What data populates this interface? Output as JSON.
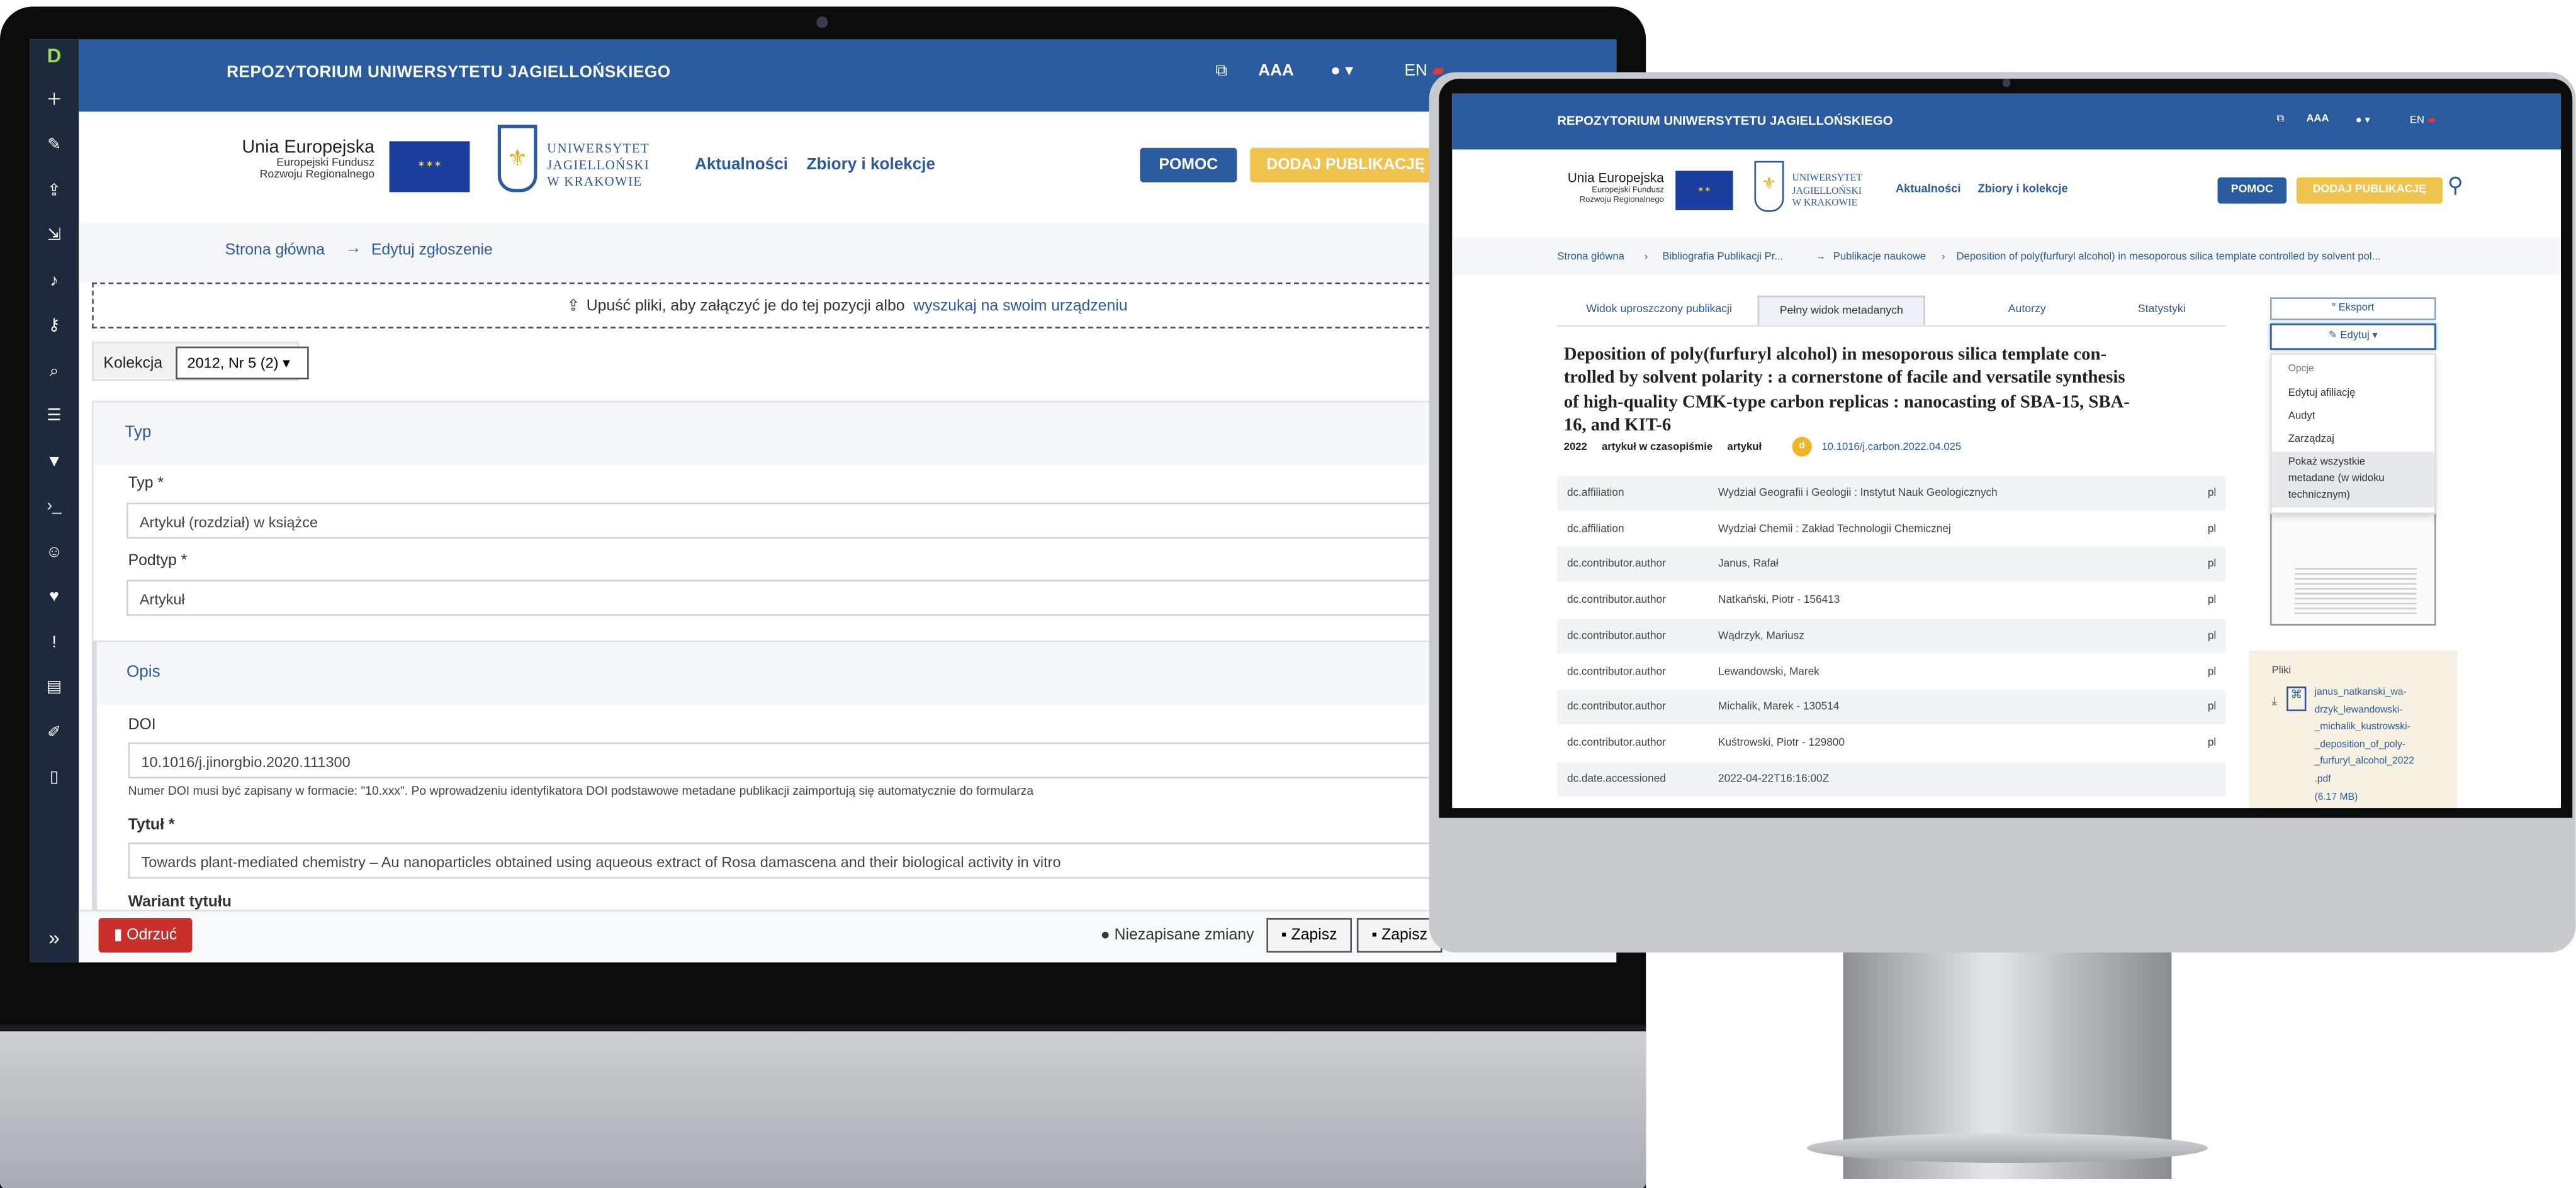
{
  "repo_title": "REPOZYTORIUM UNIWERSYTETU JAGIELLOŃSKIEGO",
  "header": {
    "font_size": "AAA",
    "lang": "EN"
  },
  "eu": {
    "name": "Unia Europejska",
    "line1": "Europejski Fundusz",
    "line2": "Rozwoju Regionalnego"
  },
  "uj": {
    "line1": "UNIWERSYTET",
    "line2": "JAGIELLOŃSKI",
    "line3": "W KRAKOWIE"
  },
  "nav": {
    "news": "Aktualności",
    "collections": "Zbiory i kolekcje"
  },
  "buttons": {
    "help": "POMOC",
    "add": "DODAJ PUBLIKACJĘ"
  },
  "laptop": {
    "breadcrumb": {
      "home": "Strona główna",
      "arrow": "→",
      "current": "Edytuj zgłoszenie"
    },
    "drop": {
      "text": "Upuść pliki, aby załączyć je do tej pozycji albo",
      "link": "wyszukaj na swoim urządzeniu"
    },
    "collection": {
      "label": "Kolekcja",
      "value": "2012, Nr 5 (2)"
    },
    "typ_panel": {
      "title": "Typ",
      "type_label": "Typ *",
      "type_value": "Artykuł (rozdział) w książce",
      "subtype_label": "Podtyp *",
      "subtype_value": "Artykuł"
    },
    "opis_panel": {
      "title": "Opis",
      "doi_label": "DOI",
      "doi_value": "10.1016/j.jinorgbio.2020.111300",
      "doi_help": "Numer DOI musi być zapisany w formacie: \"10.xxx\". Po wprowadzeniu identyfikatora DOI podstawowe metadane publikacji zaimportują się automatycznie do formularza",
      "title_label": "Tytuł *",
      "title_value": "Towards plant-mediated chemistry – Au nanoparticles obtained using aqueous extract of Rosa damascena and their biological activity in vitro",
      "variant_label": "Wariant tytułu"
    },
    "footer": {
      "discard": "Odrzuć",
      "unsaved": "Niezapisane zmiany",
      "save": "Zapisz",
      "save2": "Zapisz"
    }
  },
  "monitor": {
    "breadcrumb": {
      "home": "Strona główna",
      "b2": "Bibliografia Publikacji Pr...",
      "b3": "Publikacje naukowe",
      "b4": "Deposition of poly(furfuryl alcohol) in mesoporous silica template controlled by solvent pol..."
    },
    "tabs": [
      "Widok uproszczony publikacji",
      "Pełny widok metadanych",
      "Autorzy",
      "Statystyki"
    ],
    "title": [
      "Deposition of poly(furfuryl alcohol) in mesoporous silica template con-",
      "trolled by solvent polarity : a cornerstone of facile and versatile synthesis",
      "of high-quality CMK-type carbon replicas : nanocasting of SBA-15, SBA-",
      "16, and KIT-6"
    ],
    "meta": {
      "year": "2022",
      "kind": "artykuł w czasopiśmie",
      "sub": "artykuł",
      "doi": "10.1016/j.carbon.2022.04.025"
    },
    "rows": [
      {
        "key": "dc.affiliation",
        "value": "Wydział Geografii i Geologii : Instytut Nauk Geologicznych",
        "lang": "pl"
      },
      {
        "key": "dc.affiliation",
        "value": "Wydział Chemii : Zakład Technologii Chemicznej",
        "lang": "pl"
      },
      {
        "key": "dc.contributor.author",
        "value": "Janus, Rafał",
        "lang": "pl"
      },
      {
        "key": "dc.contributor.author",
        "value": "Natkański, Piotr - 156413",
        "lang": "pl"
      },
      {
        "key": "dc.contributor.author",
        "value": "Wądrzyk, Mariusz",
        "lang": "pl"
      },
      {
        "key": "dc.contributor.author",
        "value": "Lewandowski, Marek",
        "lang": "pl"
      },
      {
        "key": "dc.contributor.author",
        "value": "Michalik, Marek - 130514",
        "lang": "pl"
      },
      {
        "key": "dc.contributor.author",
        "value": "Kuśtrowski, Piotr - 129800",
        "lang": "pl"
      },
      {
        "key": "dc.date.accessioned",
        "value": "2022-04-22T16:16:00Z",
        "lang": ""
      }
    ],
    "export": "Eksport",
    "edit": "Edytuj",
    "dropdown": {
      "header": "Opcje",
      "items": [
        "Edytuj afiliację",
        "Audyt",
        "Zarządzaj"
      ],
      "active": [
        "Pokaż wszystkie",
        "metadane (w widoku",
        "technicznym)"
      ]
    },
    "files": {
      "label": "Pliki",
      "filename": [
        "janus_natkanski_wa-",
        "drzyk_lewandowski-",
        "_michalik_kustrowski-",
        "_deposition_of_poly-",
        "_furfuryl_alcohol_2022",
        ".pdf"
      ],
      "size": "(6.17 MB)"
    }
  }
}
